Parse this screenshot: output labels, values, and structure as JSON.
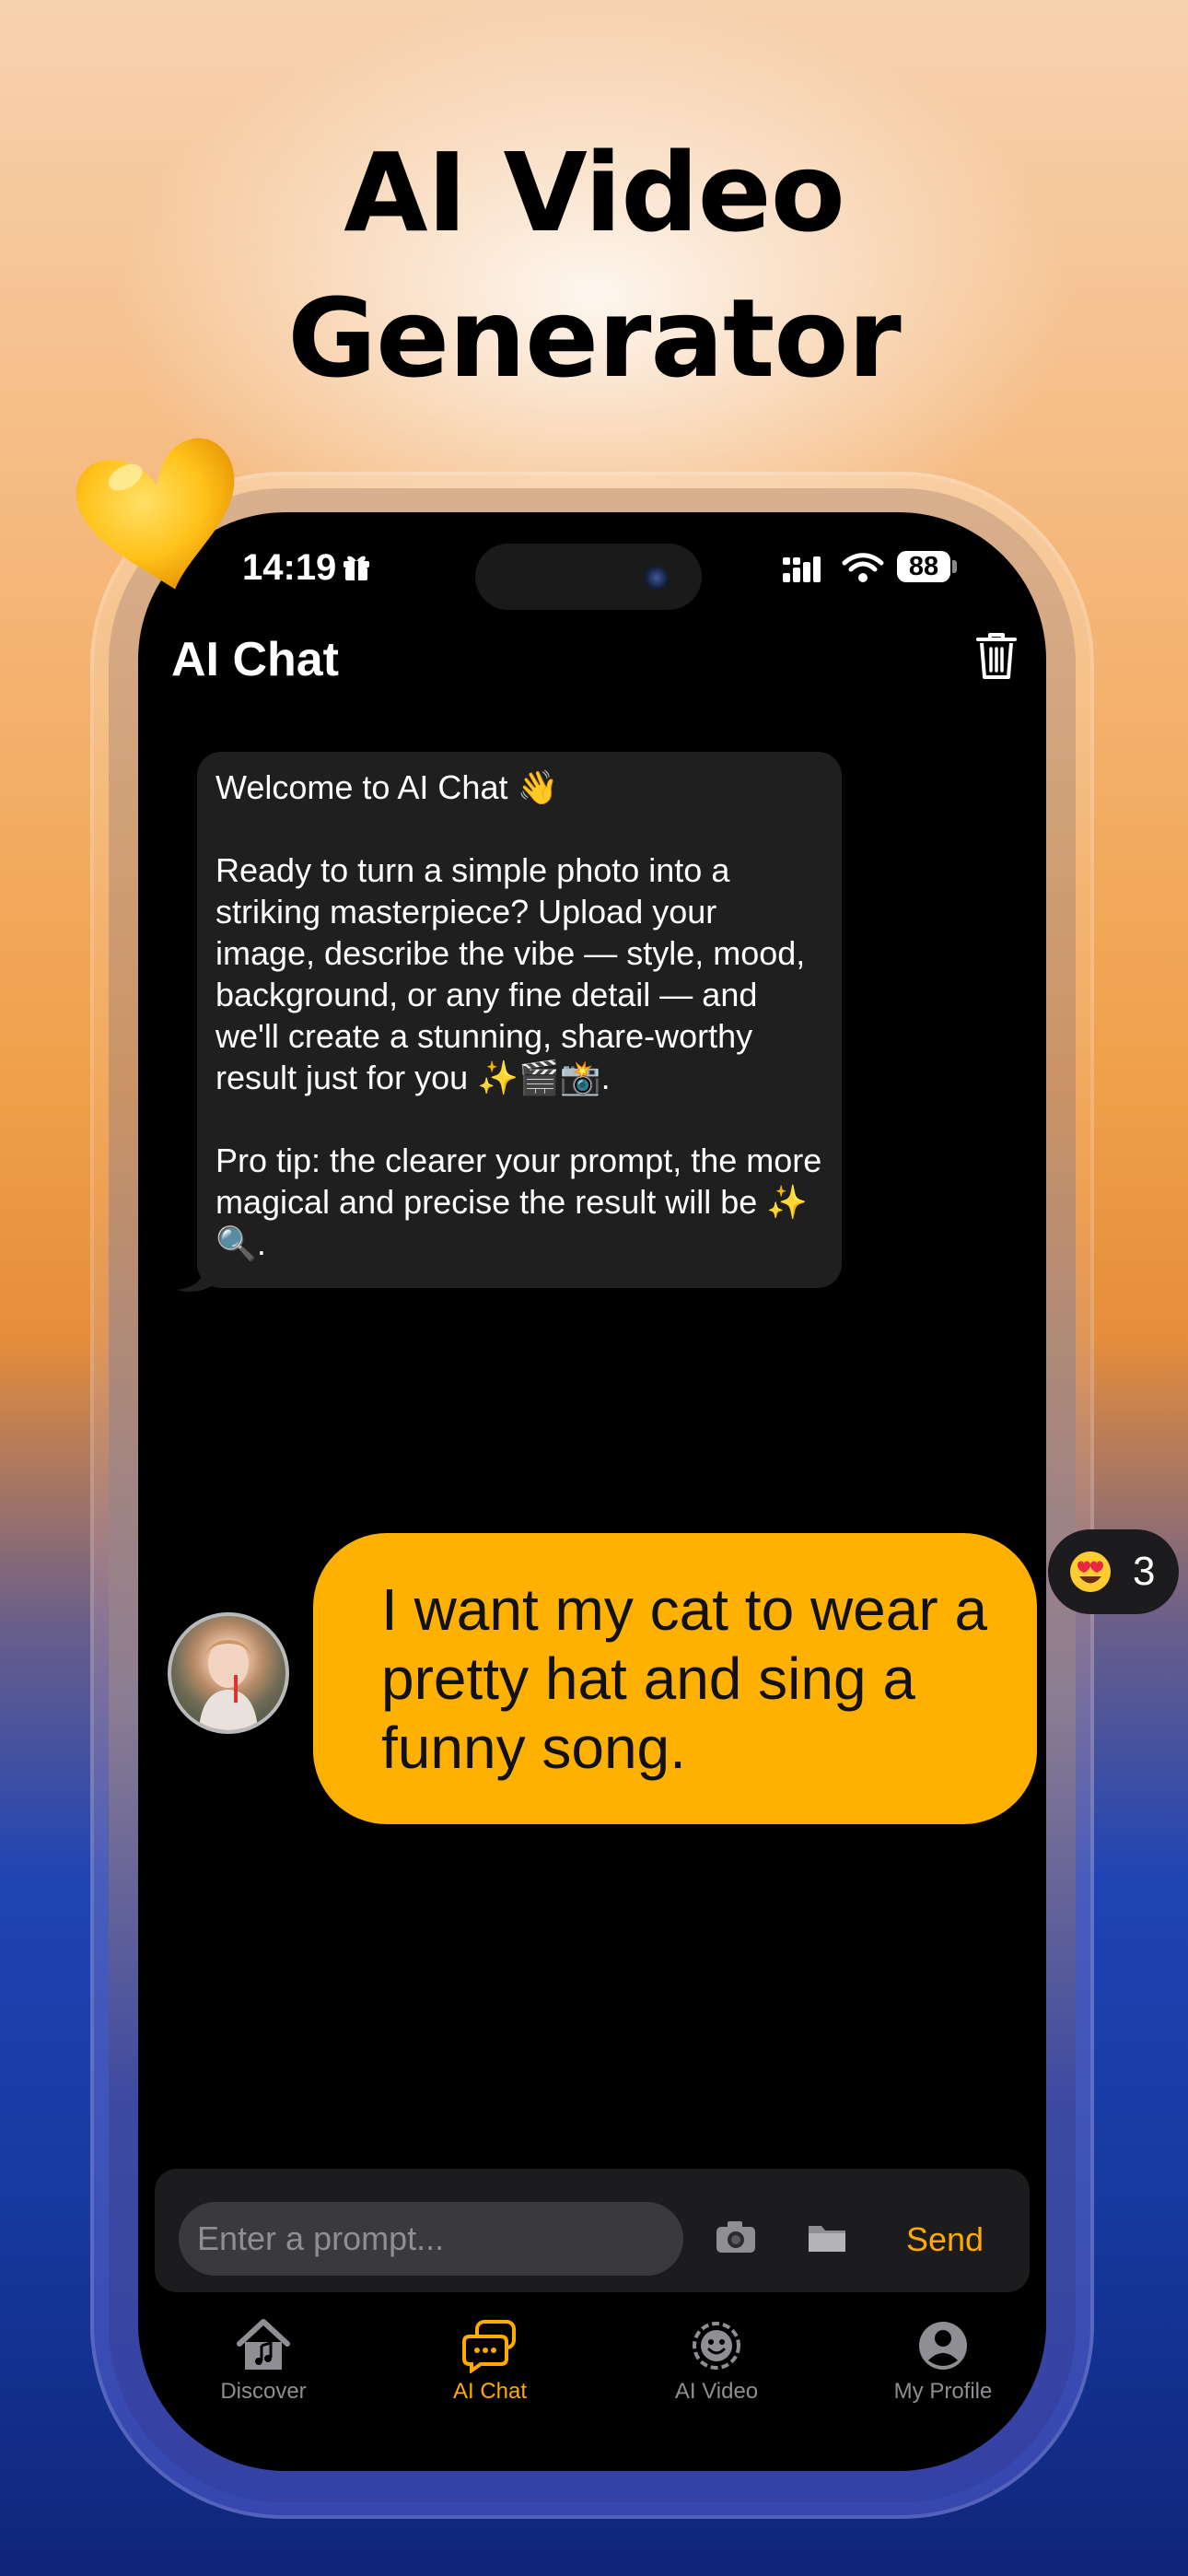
{
  "promo": {
    "title_line1": "AI Video",
    "title_line2": "Generator"
  },
  "status_bar": {
    "time": "14:19",
    "battery": "88"
  },
  "header": {
    "title": "AI Chat"
  },
  "welcome_message": {
    "line1": "Welcome to AI Chat 👋",
    "paragraph2": "Ready to turn a simple photo into a striking masterpiece? Upload your image, describe the vibe — style, mood, background, or any fine detail — and we'll create a stunning, share-worthy result just for you ✨🎬📸.",
    "paragraph3": "Pro tip: the clearer your prompt, the more magical and precise the result will be ✨🔍."
  },
  "user_message": {
    "text": "I want my cat to wear a pretty hat and sing a funny song."
  },
  "reaction": {
    "count": "3"
  },
  "input": {
    "placeholder": "Enter a prompt...",
    "send_label": "Send"
  },
  "tabs": [
    {
      "label": "Discover",
      "icon": "home-music-icon"
    },
    {
      "label": "AI Chat",
      "icon": "chat-bubbles-icon"
    },
    {
      "label": "AI Video",
      "icon": "smiley-face-icon"
    },
    {
      "label": "My Profile",
      "icon": "person-icon"
    }
  ],
  "colors": {
    "accent": "#ffb102",
    "tab_active": "#ffaa00",
    "screen_bg": "#000000",
    "bubble_bg": "#1f1f1f"
  }
}
